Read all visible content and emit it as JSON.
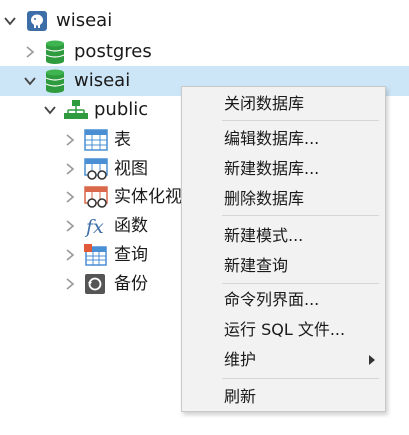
{
  "tree": {
    "connection": {
      "label": "wiseai"
    },
    "databases": [
      {
        "label": "postgres",
        "expanded": false,
        "selected": false
      },
      {
        "label": "wiseai",
        "expanded": true,
        "selected": true
      }
    ],
    "schema": {
      "label": "public"
    },
    "children": [
      {
        "label": "表",
        "icon": "table-icon"
      },
      {
        "label": "视图",
        "icon": "view-icon"
      },
      {
        "label": "实体化视",
        "icon": "materialized-view-icon"
      },
      {
        "label": "函数",
        "icon": "function-icon"
      },
      {
        "label": "查询",
        "icon": "query-icon"
      },
      {
        "label": "备份",
        "icon": "backup-icon"
      }
    ]
  },
  "context_menu": {
    "items": [
      "关闭数据库",
      "编辑数据库...",
      "新建数据库...",
      "删除数据库",
      "新建模式...",
      "新建查询",
      "命令列界面...",
      "运行 SQL 文件...",
      "维护",
      "刷新"
    ]
  },
  "colors": {
    "selection": "#cde6f7",
    "db_green": "#2e9b3e",
    "table_blue": "#4a8fd4",
    "menu_bg": "#f2f2f2"
  }
}
